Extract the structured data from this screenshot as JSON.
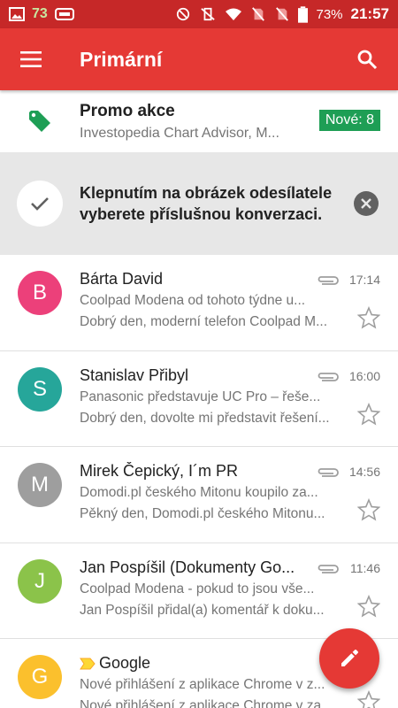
{
  "status_bar": {
    "notification_count": "73",
    "battery": "73%",
    "time": "21:57"
  },
  "app_bar": {
    "title": "Primární"
  },
  "promo": {
    "title": "Promo akce",
    "subtitle": "Investopedia Chart Advisor, M...",
    "badge": "Nové: 8",
    "icon": "tag-icon",
    "icon_color": "#1e9e55"
  },
  "tip": {
    "text": "Klepnutím na obrázek odesílatele vyberete příslušnou konverzaci."
  },
  "emails": [
    {
      "avatar_letter": "B",
      "avatar_color": "#ec407a",
      "sender": "Bárta David",
      "subject": "Coolpad Modena od tohoto týdne u...",
      "snippet": "Dobrý den, moderní telefon Coolpad M...",
      "time": "17:14",
      "has_attachment": true,
      "important": false
    },
    {
      "avatar_letter": "S",
      "avatar_color": "#26a69a",
      "sender": "Stanislav Přibyl",
      "subject": "Panasonic představuje UC Pro – řeše...",
      "snippet": "Dobrý den, dovolte mi představit řešení...",
      "time": "16:00",
      "has_attachment": true,
      "important": false
    },
    {
      "avatar_letter": "M",
      "avatar_color": "#9e9e9e",
      "sender": "Mirek Čepický, I´m PR",
      "subject": "Domodi.pl českého Mitonu koupilo za...",
      "snippet": "Pěkný den, Domodi.pl českého Mitonu...",
      "time": "14:56",
      "has_attachment": true,
      "important": false
    },
    {
      "avatar_letter": "J",
      "avatar_color": "#8bc34a",
      "sender": "Jan Pospíšil (Dokumenty Go...",
      "subject": "Coolpad Modena  - pokud to jsou vše...",
      "snippet": "Jan Pospíšil přidal(a) komentář k doku...",
      "time": "11:46",
      "has_attachment": true,
      "important": false
    },
    {
      "avatar_letter": "G",
      "avatar_color": "#fbc02d",
      "sender": "Google",
      "subject": "Nové přihlášení z aplikace Chrome v z...",
      "snippet": "Nové přihlášení z aplikace Chrome v za...",
      "time": "",
      "has_attachment": false,
      "important": true
    }
  ],
  "fab": {
    "icon": "pencil-icon"
  }
}
